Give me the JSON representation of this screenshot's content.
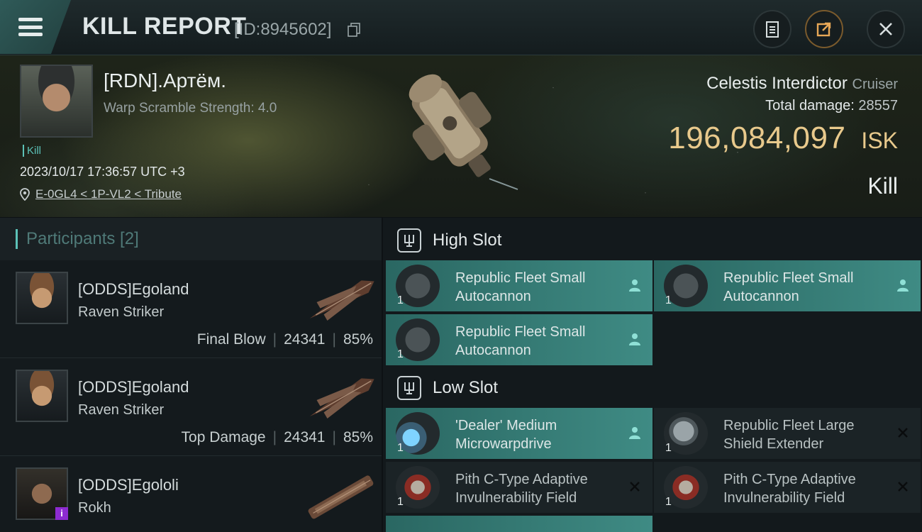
{
  "header": {
    "title": "KILL REPORT",
    "id_label": "[ID:8945602]"
  },
  "victim": {
    "name": "[RDN].Артём.",
    "warp": "Warp Scramble Strength: 4.0",
    "tag": "Kill",
    "date": "2023/10/17 17:36:57 UTC +3",
    "location": "E-0GL4 < 1P-VL2 < Tribute",
    "ship_name": "Celestis Interdictor",
    "ship_class": "Cruiser",
    "total_damage_label": "Total damage:",
    "total_damage": "28557",
    "isk_value": "196,084,097",
    "isk_unit": "ISK",
    "result": "Kill"
  },
  "participants": {
    "label": "Participants [2]",
    "rows": [
      {
        "name": "[ODDS]Egoland",
        "ship": "Raven Striker",
        "role": "Final Blow",
        "damage": "24341",
        "percent": "85%"
      },
      {
        "name": "[ODDS]Egoland",
        "ship": "Raven Striker",
        "role": "Top Damage",
        "damage": "24341",
        "percent": "85%"
      },
      {
        "name": "[ODDS]Egololi",
        "ship": "Rokh",
        "badge": "i"
      }
    ]
  },
  "high_slot": {
    "title": "High Slot",
    "items": [
      {
        "name": "Republic Fleet Small Autocannon",
        "qty": "1"
      },
      {
        "name": "Republic Fleet Small Autocannon",
        "qty": "1"
      },
      {
        "name": "Republic Fleet Small Autocannon",
        "qty": "1"
      }
    ]
  },
  "low_slot": {
    "title": "Low Slot",
    "items": [
      {
        "name": "'Dealer' Medium Microwarpdrive",
        "qty": "1"
      },
      {
        "name": "Republic Fleet Large Shield Extender",
        "qty": "1"
      },
      {
        "name": "Pith C-Type Adaptive Invulnerability Field",
        "qty": "1"
      },
      {
        "name": "Pith C-Type Adaptive Invulnerability Field",
        "qty": "1"
      }
    ]
  },
  "colors": {
    "accent": "#5cc2b8",
    "isk": "#e8c98c",
    "dropped": "#3f8b84",
    "destroyed": "#1b2326"
  }
}
